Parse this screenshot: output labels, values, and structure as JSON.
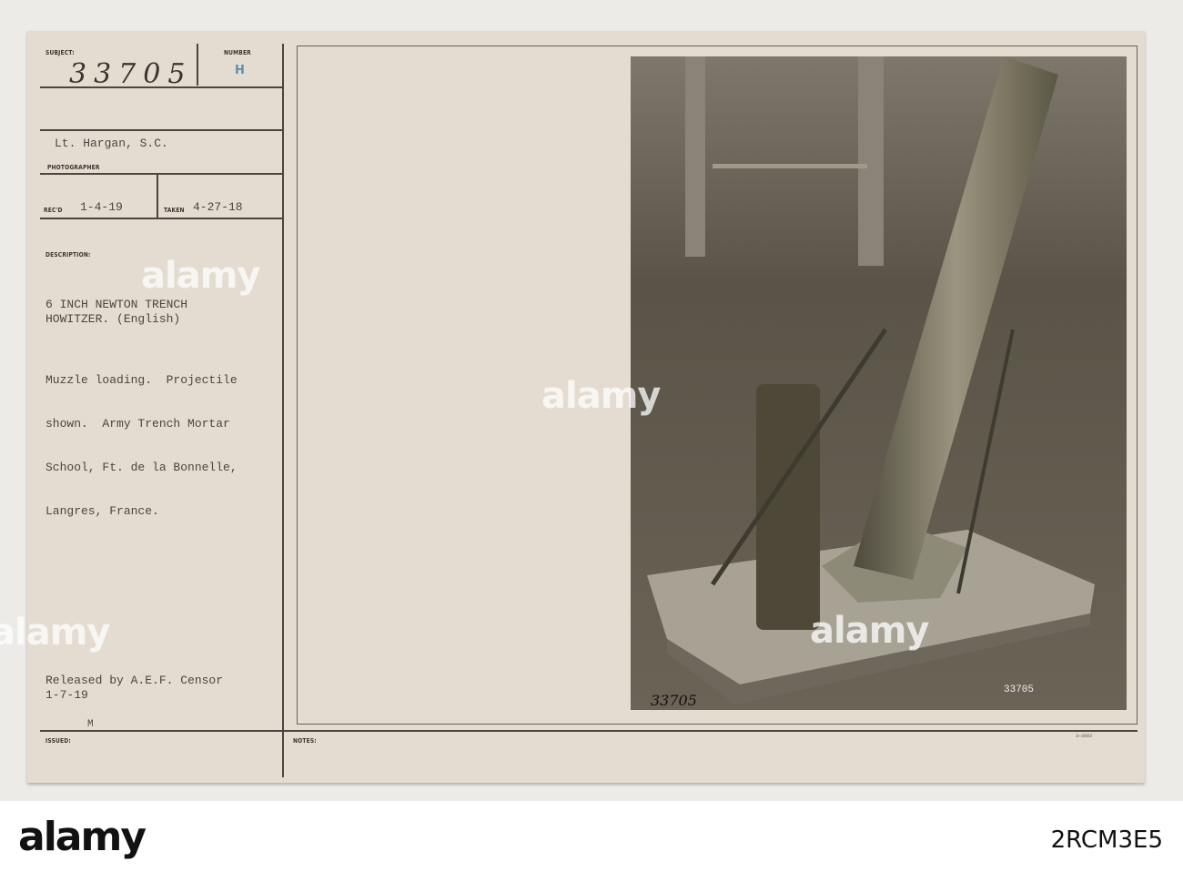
{
  "card": {
    "subject_label": "SUBJECT:",
    "subject_number": "33705",
    "number_label": "NUMBER",
    "number_stamp": "H",
    "photographer": "Lt. Hargan, S.C.",
    "photographer_label": "PHOTOGRAPHER",
    "recd_label": "REC'D",
    "recd_date": "1-4-19",
    "taken_label": "TAKEN",
    "taken_date": "4-27-18",
    "description_label": "DESCRIPTION:",
    "title_line1": "6 INCH NEWTON TRENCH",
    "title_line2": "HOWITZER. (English)",
    "body_lines": [
      "Muzzle loading.  Projectile",
      "shown.  Army Trench Mortar",
      "School, Ft. de la Bonnelle,",
      "Langres, France."
    ],
    "release_line1": "Released by A.E.F. Censor",
    "release_line2": "1-7-19",
    "issued_label": "ISSUED:",
    "issued_mark": "M",
    "notes_label": "NOTES:",
    "form_code": "3—3603"
  },
  "photo": {
    "print_number": "33705",
    "scrawl_number": "33705"
  },
  "watermark": {
    "text": "alamy"
  },
  "footer": {
    "logo": "alamy",
    "image_id": "2RCM3E5"
  }
}
